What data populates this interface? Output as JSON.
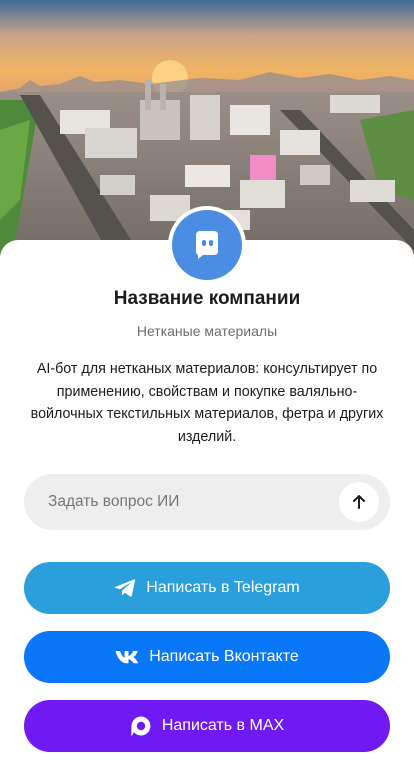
{
  "company": {
    "name": "Название компании",
    "category": "Нетканые материалы",
    "description": "AI-бот для нетканых материалов: консультирует по применению, свойствам и покупке валяльно-войлочных текстильных материалов, фетра и других изделий."
  },
  "ask": {
    "placeholder": "Задать вопрос ИИ",
    "send_icon": "arrow-up-icon"
  },
  "buttons": {
    "telegram": {
      "label": "Написать в Telegram",
      "icon": "telegram-icon",
      "color": "#2b9fdc"
    },
    "vk": {
      "label": "Написать Вконтакте",
      "icon": "vk-icon",
      "color": "#0a77f8"
    },
    "max": {
      "label": "Написать в MAX",
      "icon": "max-icon",
      "color": "#6f19f4"
    }
  },
  "colors": {
    "avatar": "#4a8de2",
    "input_bg": "#eeeeef"
  }
}
